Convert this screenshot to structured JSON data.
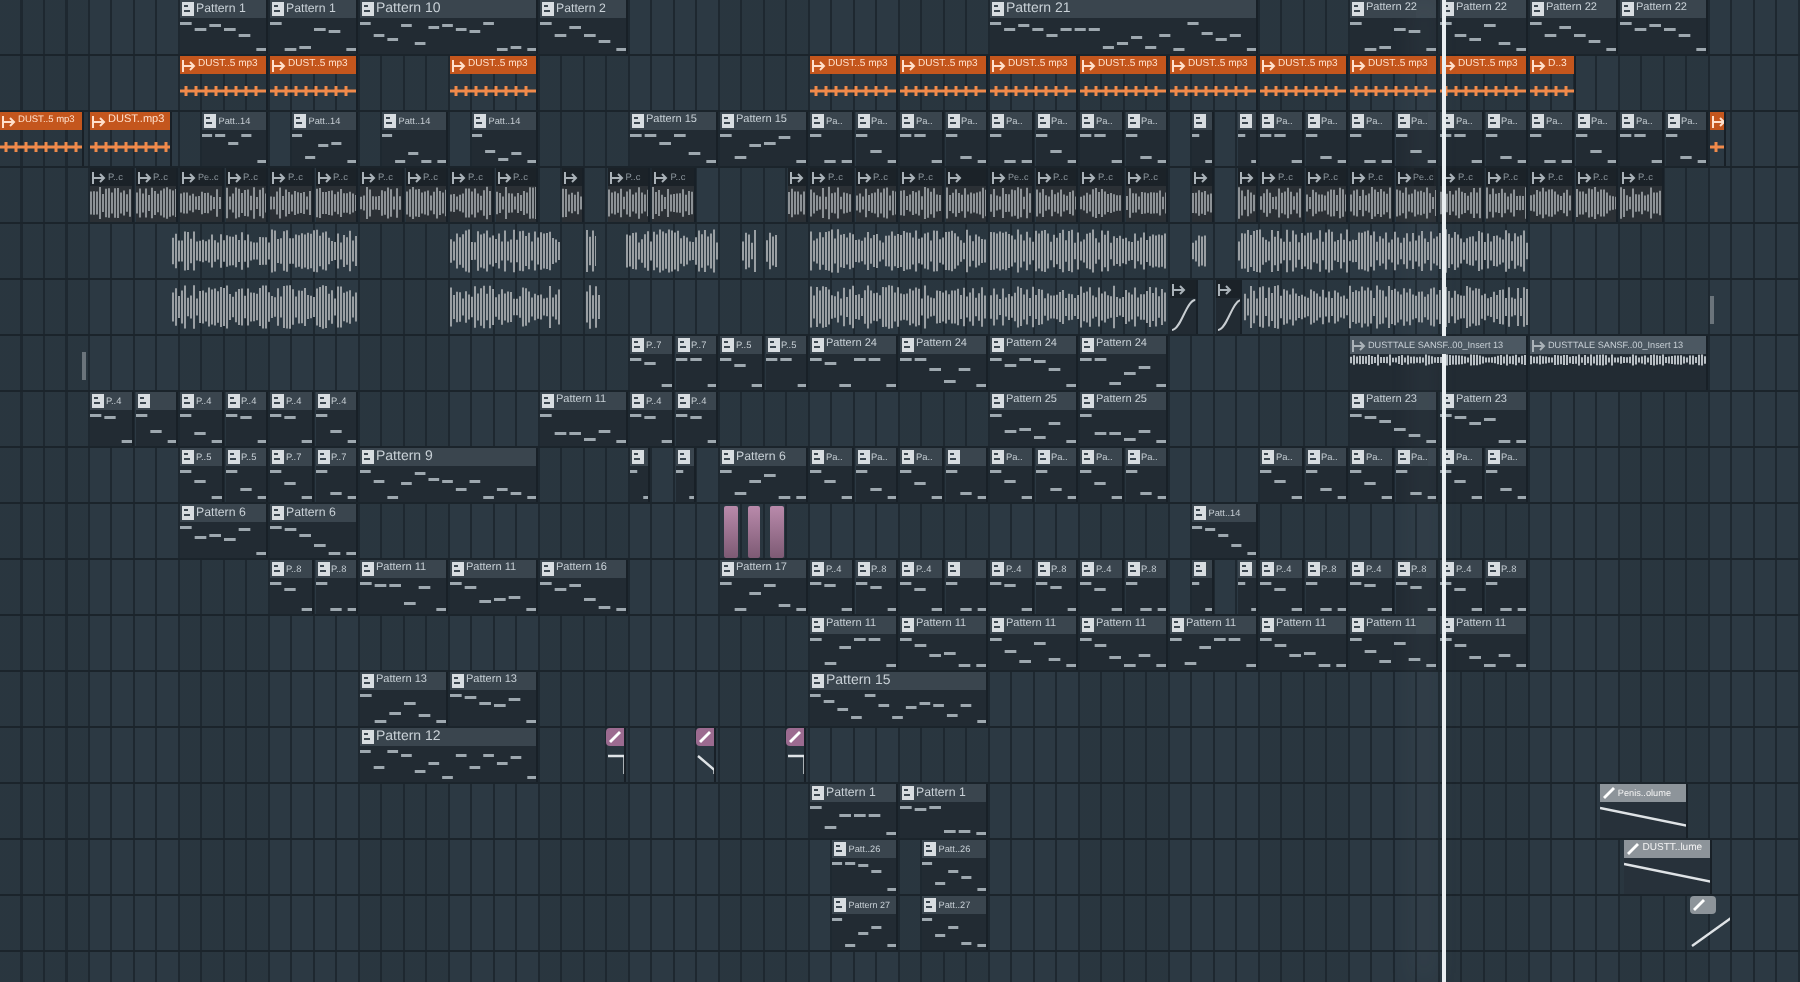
{
  "tracks": [
    {
      "clips": [
        {
          "kind": "pattern",
          "label": "Pattern 1"
        },
        {
          "kind": "pattern",
          "label": "Pattern 1"
        },
        {
          "kind": "pattern",
          "label": "Pattern 10"
        },
        {
          "kind": "pattern",
          "label": "Pattern 2"
        },
        {
          "kind": "pattern",
          "label": "Pattern 21"
        },
        {
          "kind": "pattern",
          "label": "Pattern 22"
        },
        {
          "kind": "pattern",
          "label": "Pattern 22"
        },
        {
          "kind": "pattern",
          "label": "Pattern 22"
        },
        {
          "kind": "pattern",
          "label": "Pattern 22"
        }
      ]
    },
    {
      "clips": [
        {
          "kind": "audio",
          "label": "DUST..5 mp3"
        },
        {
          "kind": "audio",
          "label": "DUST..5 mp3"
        },
        {
          "kind": "audio",
          "label": "DUST..5 mp3"
        },
        {
          "kind": "audio",
          "label": "DUST..5 mp3"
        },
        {
          "kind": "audio",
          "label": "DUST..5 mp3"
        },
        {
          "kind": "audio",
          "label": "DUST..5 mp3"
        },
        {
          "kind": "audio",
          "label": "DUST..5 mp3"
        },
        {
          "kind": "audio",
          "label": "DUST..5 mp3"
        },
        {
          "kind": "audio",
          "label": "DUST..5 mp3"
        },
        {
          "kind": "audio",
          "label": "DUST..5 mp3"
        },
        {
          "kind": "audio",
          "label": "DUST..5 mp3"
        },
        {
          "kind": "audio",
          "label": "D..3"
        }
      ]
    },
    {
      "clips": [
        {
          "kind": "audio",
          "label": "DUST..5 mp3"
        },
        {
          "kind": "audio",
          "label": "DUST..mp3"
        },
        {
          "kind": "pattern",
          "label": "Patt..14"
        },
        {
          "kind": "pattern",
          "label": "Patt..14"
        },
        {
          "kind": "pattern",
          "label": "Patt..14"
        },
        {
          "kind": "pattern",
          "label": "Patt..14"
        },
        {
          "kind": "pattern",
          "label": "Pattern 15"
        },
        {
          "kind": "pattern",
          "label": "Pattern 15"
        },
        {
          "kind": "pattern",
          "label": "Pa.."
        },
        {
          "kind": "pattern",
          "label": "Pa.."
        },
        {
          "kind": "pattern",
          "label": "Pa.."
        },
        {
          "kind": "pattern",
          "label": "Pa.."
        },
        {
          "kind": "pattern",
          "label": "Pa.."
        },
        {
          "kind": "pattern",
          "label": "Pa.."
        },
        {
          "kind": "pattern",
          "label": "Pa.."
        },
        {
          "kind": "pattern",
          "label": "Pa.."
        },
        {
          "kind": "pattern"
        },
        {
          "kind": "pattern"
        },
        {
          "kind": "pattern",
          "label": "Pa.."
        },
        {
          "kind": "pattern",
          "label": "Pa.."
        },
        {
          "kind": "pattern",
          "label": "Pa.."
        },
        {
          "kind": "pattern",
          "label": "Pa.."
        },
        {
          "kind": "pattern",
          "label": "Pa.."
        },
        {
          "kind": "pattern",
          "label": "Pa.."
        },
        {
          "kind": "pattern",
          "label": "Pa.."
        },
        {
          "kind": "pattern",
          "label": "Pa.."
        },
        {
          "kind": "pattern",
          "label": "Pa.."
        },
        {
          "kind": "pattern",
          "label": "Pa.."
        },
        {
          "kind": "audio"
        }
      ]
    },
    {
      "clips": [
        {
          "kind": "sample",
          "label": "P..c"
        },
        {
          "kind": "sample",
          "label": "P..c"
        },
        {
          "kind": "sample",
          "label": "Pe..c"
        },
        {
          "kind": "sample",
          "label": "P..c"
        },
        {
          "kind": "sample",
          "label": "P..c"
        },
        {
          "kind": "sample",
          "label": "P..c"
        },
        {
          "kind": "sample",
          "label": "P..c"
        },
        {
          "kind": "sample",
          "label": "P..c"
        },
        {
          "kind": "sample",
          "label": "P..c"
        },
        {
          "kind": "sample",
          "label": "P..c"
        },
        {
          "kind": "sample"
        },
        {
          "kind": "sample",
          "label": "P..c"
        },
        {
          "kind": "sample",
          "label": "P..c"
        },
        {
          "kind": "sample"
        },
        {
          "kind": "sample",
          "label": "P..c"
        },
        {
          "kind": "sample",
          "label": "P..c"
        },
        {
          "kind": "sample",
          "label": "P..c"
        },
        {
          "kind": "sample"
        },
        {
          "kind": "sample",
          "label": "Pe..c"
        },
        {
          "kind": "sample",
          "label": "P..c"
        },
        {
          "kind": "sample",
          "label": "P..c"
        },
        {
          "kind": "sample",
          "label": "P..c"
        },
        {
          "kind": "sample"
        },
        {
          "kind": "sample"
        },
        {
          "kind": "sample",
          "label": "P..c"
        },
        {
          "kind": "sample",
          "label": "P..c"
        },
        {
          "kind": "sample",
          "label": "P..c"
        },
        {
          "kind": "sample",
          "label": "Pe..c"
        },
        {
          "kind": "sample",
          "label": "P..c"
        },
        {
          "kind": "sample",
          "label": "P..c"
        },
        {
          "kind": "sample",
          "label": "P..c"
        },
        {
          "kind": "sample",
          "label": "P..c"
        },
        {
          "kind": "sample",
          "label": "P..c"
        }
      ]
    },
    {
      "clips": [
        {
          "kind": "waveform"
        },
        {
          "kind": "waveform"
        },
        {
          "kind": "waveform"
        },
        {
          "kind": "waveform"
        },
        {
          "kind": "waveform"
        },
        {
          "kind": "waveform"
        },
        {
          "kind": "waveform"
        },
        {
          "kind": "waveform"
        },
        {
          "kind": "waveform"
        },
        {
          "kind": "waveform"
        }
      ]
    },
    {
      "clips": [
        {
          "kind": "waveform"
        },
        {
          "kind": "waveform"
        },
        {
          "kind": "waveform"
        },
        {
          "kind": "waveform"
        },
        {
          "kind": "waveform"
        },
        {
          "kind": "fade"
        },
        {
          "kind": "fade"
        },
        {
          "kind": "waveform"
        },
        {
          "kind": "marker"
        }
      ]
    },
    {
      "clips": [
        {
          "kind": "marker"
        },
        {
          "kind": "pattern",
          "label": "P..7"
        },
        {
          "kind": "pattern",
          "label": "P..7"
        },
        {
          "kind": "pattern",
          "label": "P..5"
        },
        {
          "kind": "pattern",
          "label": "P..5"
        },
        {
          "kind": "pattern",
          "label": "Pattern 24"
        },
        {
          "kind": "pattern",
          "label": "Pattern 24"
        },
        {
          "kind": "pattern",
          "label": "Pattern 24"
        },
        {
          "kind": "pattern",
          "label": "Pattern 24"
        },
        {
          "kind": "recording",
          "label": "DUSTTALE SANSF..00_Insert 13"
        },
        {
          "kind": "recording",
          "label": "DUSTTALE SANSF..00_Insert 13"
        }
      ]
    },
    {
      "clips": [
        {
          "kind": "pattern",
          "label": "P..4"
        },
        {
          "kind": "pattern"
        },
        {
          "kind": "pattern",
          "label": "P..4"
        },
        {
          "kind": "pattern",
          "label": "P..4"
        },
        {
          "kind": "pattern",
          "label": "P..4"
        },
        {
          "kind": "pattern",
          "label": "P..4"
        },
        {
          "kind": "pattern",
          "label": "Pattern 11"
        },
        {
          "kind": "pattern",
          "label": "P..4"
        },
        {
          "kind": "pattern",
          "label": "P..4"
        },
        {
          "kind": "pattern",
          "label": "Pattern 25"
        },
        {
          "kind": "pattern",
          "label": "Pattern 25"
        },
        {
          "kind": "pattern",
          "label": "Pattern 23"
        },
        {
          "kind": "pattern",
          "label": "Pattern 23"
        }
      ]
    },
    {
      "clips": [
        {
          "kind": "pattern",
          "label": "P..5"
        },
        {
          "kind": "pattern",
          "label": "P..5"
        },
        {
          "kind": "pattern",
          "label": "P..7"
        },
        {
          "kind": "pattern",
          "label": "P..7"
        },
        {
          "kind": "pattern",
          "label": "Pattern 9"
        },
        {
          "kind": "pattern"
        },
        {
          "kind": "pattern"
        },
        {
          "kind": "pattern",
          "label": "Pattern 6"
        },
        {
          "kind": "pattern",
          "label": "Pa.."
        },
        {
          "kind": "pattern",
          "label": "Pa.."
        },
        {
          "kind": "pattern",
          "label": "Pa.."
        },
        {
          "kind": "pattern"
        },
        {
          "kind": "pattern",
          "label": "Pa.."
        },
        {
          "kind": "pattern",
          "label": "Pa.."
        },
        {
          "kind": "pattern",
          "label": "Pa.."
        },
        {
          "kind": "pattern",
          "label": "Pa.."
        },
        {
          "kind": "pattern",
          "label": "Pa.."
        },
        {
          "kind": "pattern",
          "label": "Pa.."
        },
        {
          "kind": "pattern",
          "label": "Pa.."
        },
        {
          "kind": "pattern",
          "label": "Pa.."
        },
        {
          "kind": "pattern",
          "label": "Pa.."
        },
        {
          "kind": "pattern",
          "label": "Pa.."
        }
      ]
    },
    {
      "clips": [
        {
          "kind": "pattern",
          "label": "Pattern 6"
        },
        {
          "kind": "pattern",
          "label": "Pattern 6"
        },
        {
          "kind": "strip"
        },
        {
          "kind": "strip"
        },
        {
          "kind": "strip"
        },
        {
          "kind": "pattern",
          "label": "Patt..14"
        }
      ]
    },
    {
      "clips": [
        {
          "kind": "pattern",
          "label": "P..8"
        },
        {
          "kind": "pattern",
          "label": "P..8"
        },
        {
          "kind": "pattern",
          "label": "Pattern 11"
        },
        {
          "kind": "pattern",
          "label": "Pattern 11"
        },
        {
          "kind": "pattern",
          "label": "Pattern 16"
        },
        {
          "kind": "pattern",
          "label": "Pattern 17"
        },
        {
          "kind": "pattern",
          "label": "P..4"
        },
        {
          "kind": "pattern",
          "label": "P..8"
        },
        {
          "kind": "pattern",
          "label": "P..4"
        },
        {
          "kind": "pattern"
        },
        {
          "kind": "pattern",
          "label": "P..4"
        },
        {
          "kind": "pattern",
          "label": "P..8"
        },
        {
          "kind": "pattern",
          "label": "P..4"
        },
        {
          "kind": "pattern",
          "label": "P..8"
        },
        {
          "kind": "pattern"
        },
        {
          "kind": "pattern"
        },
        {
          "kind": "pattern",
          "label": "P..4"
        },
        {
          "kind": "pattern",
          "label": "P..8"
        },
        {
          "kind": "pattern",
          "label": "P..4"
        },
        {
          "kind": "pattern",
          "label": "P..8"
        },
        {
          "kind": "pattern",
          "label": "P..4"
        },
        {
          "kind": "pattern",
          "label": "P..8"
        }
      ]
    },
    {
      "clips": [
        {
          "kind": "pattern",
          "label": "Pattern 11"
        },
        {
          "kind": "pattern",
          "label": "Pattern 11"
        },
        {
          "kind": "pattern",
          "label": "Pattern 11"
        },
        {
          "kind": "pattern",
          "label": "Pattern 11"
        },
        {
          "kind": "pattern",
          "label": "Pattern 11"
        },
        {
          "kind": "pattern",
          "label": "Pattern 11"
        },
        {
          "kind": "pattern",
          "label": "Pattern 11"
        },
        {
          "kind": "pattern",
          "label": "Pattern 11"
        }
      ]
    },
    {
      "clips": [
        {
          "kind": "pattern",
          "label": "Pattern 13"
        },
        {
          "kind": "pattern",
          "label": "Pattern 13"
        },
        {
          "kind": "pattern",
          "label": "Pattern 15"
        }
      ]
    },
    {
      "clips": [
        {
          "kind": "pattern",
          "label": "Pattern 12"
        },
        {
          "kind": "automation",
          "color": "#9c6b90"
        },
        {
          "kind": "automation",
          "color": "#9c6b90"
        },
        {
          "kind": "automation",
          "color": "#9c6b90"
        }
      ]
    },
    {
      "clips": [
        {
          "kind": "pattern",
          "label": "Pattern 1"
        },
        {
          "kind": "pattern",
          "label": "Pattern 1"
        },
        {
          "kind": "automation",
          "label": "Penis..olume",
          "color": "#8d949a"
        }
      ]
    },
    {
      "clips": [
        {
          "kind": "pattern",
          "label": "Patt..26"
        },
        {
          "kind": "pattern",
          "label": "Patt..26"
        },
        {
          "kind": "automation",
          "label": "DUSTT..lume",
          "color": "#8d949a"
        }
      ]
    },
    {
      "clips": [
        {
          "kind": "pattern",
          "label": "Pattern 27"
        },
        {
          "kind": "pattern",
          "label": "Patt..27"
        },
        {
          "kind": "automation",
          "color": "#8d949a"
        }
      ]
    }
  ]
}
